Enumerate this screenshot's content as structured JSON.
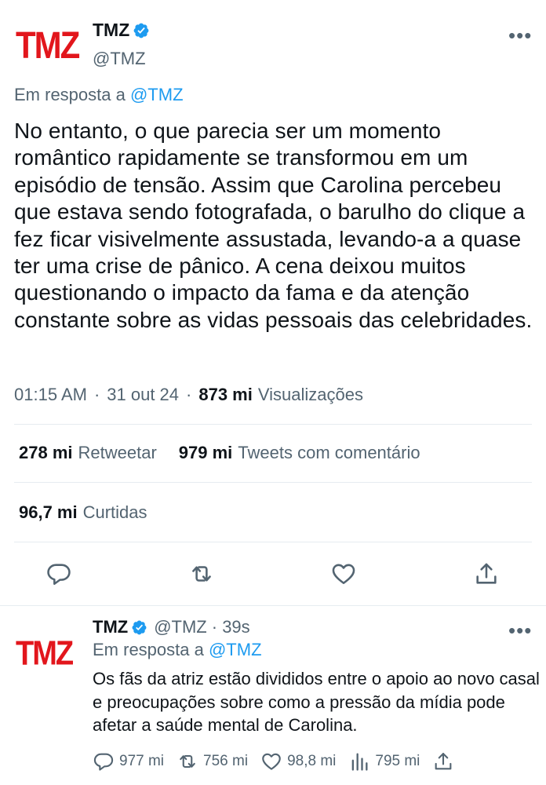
{
  "main_tweet": {
    "logo_text": "TMZ",
    "author_name": "TMZ",
    "author_handle": "@TMZ",
    "reply_prefix": "Em resposta a",
    "reply_mention": "@TMZ",
    "text": "No entanto, o que parecia ser um momento romântico rapidamente se transformou em um episódio de tensão. Assim que Carolina percebeu que estava sendo fotografada, o barulho do clique a fez ficar visivelmente assustada, levando-a a quase ter uma crise de pânico. A cena deixou muitos questionando o impacto da fama e da atenção constante sobre as vidas pessoais das celebridades.",
    "time": "01:15 AM",
    "date": "31 out 24",
    "views_count": "873 mi",
    "views_label": "Visualizações",
    "retweets_count": "278 mi",
    "retweets_label": "Retweetar",
    "quotes_count": "979 mi",
    "quotes_label": "Tweets com comentário",
    "likes_count": "96,7 mi",
    "likes_label": "Curtidas",
    "more_label": "•••"
  },
  "reply_tweet": {
    "logo_text": "TMZ",
    "author_name": "TMZ",
    "author_handle": "@TMZ",
    "time_ago": "· 39s",
    "reply_prefix": "Em resposta a",
    "reply_mention": "@TMZ",
    "text": "Os fãs da atriz estão divididos entre o apoio ao novo casal e preocupações sobre como a pressão da mídia pode afetar a saúde mental de Carolina.",
    "replies": "977 mi",
    "retweets": "756 mi",
    "likes": "98,8 mi",
    "views": "795 mi",
    "more_label": "•••"
  },
  "icons": {
    "verified": "verified-badge-icon",
    "reply": "reply-icon",
    "retweet": "retweet-icon",
    "like": "heart-icon",
    "share": "share-icon",
    "views": "views-icon"
  },
  "colors": {
    "brand_red": "#e2161c",
    "link_blue": "#1d9bf0",
    "muted": "#536471",
    "text": "#0f1419"
  }
}
